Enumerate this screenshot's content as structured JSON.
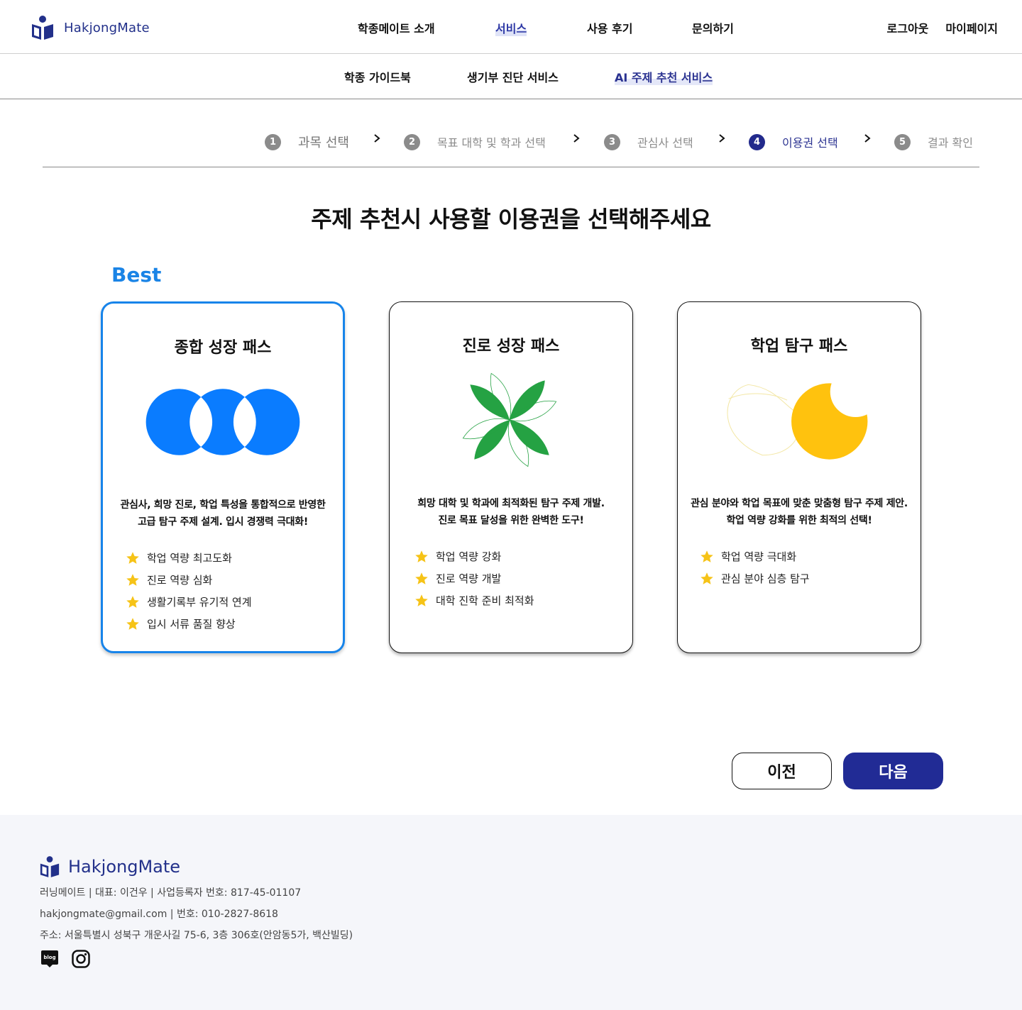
{
  "header": {
    "logo_text": "HakjongMate",
    "nav": [
      "학종메이트 소개",
      "서비스",
      "사용 후기",
      "문의하기"
    ],
    "active_nav": "서비스",
    "logout": "로그아웃",
    "mypage": "마이페이지"
  },
  "subnav": {
    "items": [
      "학종 가이드북",
      "생기부 진단 서비스",
      "AI 주제 추천 서비스"
    ],
    "active": "AI 주제 추천 서비스"
  },
  "stepper": {
    "steps": [
      {
        "num": "1",
        "label": "과목 선택"
      },
      {
        "num": "2",
        "label": "목표 대학 및 학과 선택"
      },
      {
        "num": "3",
        "label": "관심사 선택"
      },
      {
        "num": "4",
        "label": "이용권 선택"
      },
      {
        "num": "5",
        "label": "결과 확인"
      }
    ],
    "current_step": 4
  },
  "main": {
    "title": "주제 추천시 사용할 이용권을 선택해주세요",
    "best_label": "Best"
  },
  "cards": [
    {
      "title": "종합 성장 패스",
      "desc_line1": "관심사, 희망 진로, 학업 특성을 통합적으로 반영한",
      "desc_line2": "고급 탐구 주제 설계. 입시 경쟁력 극대화!",
      "features": [
        "학업 역량 최고도화",
        "진로 역량 심화",
        "생활기록부 유기적 연계",
        "입시 서류 품질 향상"
      ],
      "icon": "overlapping-circles-icon",
      "color": "#0a7cff",
      "selected": true
    },
    {
      "title": "진로 성장 패스",
      "desc_line1": "희망 대학 및 학과에 최적화된 탐구 주제 개발.",
      "desc_line2": "진로 목표 달성을 위한 완벽한 도구!",
      "features": [
        "학업 역량 강화",
        "진로 역량 개발",
        "대학 진학 준비 최적화"
      ],
      "icon": "leaf-flower-icon",
      "color": "#25a243",
      "selected": false
    },
    {
      "title": "학업 탐구 패스",
      "desc_line1": "관심 분야와 학업 목표에 맞춘 맞춤형 탐구 주제 제안.",
      "desc_line2": "학업 역량 강화를 위한 최적의 선택!",
      "features": [
        "학업 역량 극대화",
        "관심 분야 심층 탐구"
      ],
      "icon": "crescent-moon-icon",
      "color": "#ffc20e",
      "selected": false
    }
  ],
  "buttons": {
    "prev": "이전",
    "next": "다음"
  },
  "footer": {
    "logo_text": "HakjongMate",
    "line1": "러닝메이트 | 대표: 이건우 | 사업등록자 번호: 817-45-01107",
    "line2": "hakjongmate@gmail.com | 번호: 010-2827-8618",
    "line3": "주소: 서울특별시 성북구 개운사길 75-6, 3층 306호(안암동5가, 백산빌딩)",
    "blog_icon_text": "blog",
    "social": [
      "blog-icon",
      "instagram-icon"
    ]
  },
  "colors": {
    "brand": "#22308a",
    "primary_button": "#212b95",
    "best_accent": "#1a84e6",
    "star": "#f6c317"
  }
}
